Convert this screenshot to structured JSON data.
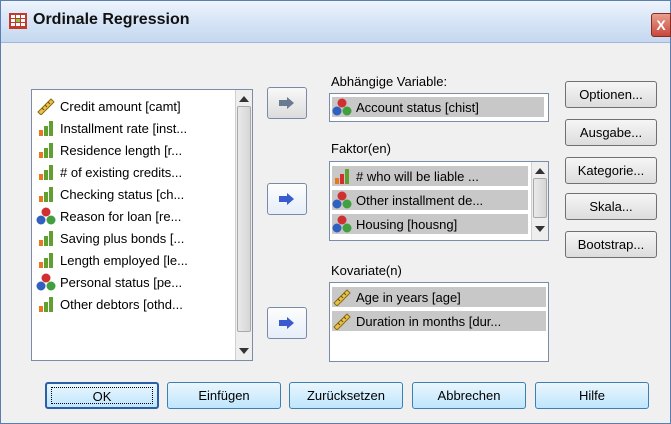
{
  "window": {
    "title": "Ordinale Regression",
    "close_glyph": "X"
  },
  "source_list": {
    "items": [
      {
        "label": "Credit amount [camt]",
        "icon": "scale-ruler-icon"
      },
      {
        "label": "Installment rate [inst...",
        "icon": "ordinal-bars-icon"
      },
      {
        "label": "Residence length [r...",
        "icon": "ordinal-bars-icon"
      },
      {
        "label": "# of existing credits...",
        "icon": "ordinal-bars-icon"
      },
      {
        "label": "Checking status [ch...",
        "icon": "ordinal-bars-icon"
      },
      {
        "label": "Reason for loan [re...",
        "icon": "nominal-balls-icon"
      },
      {
        "label": "Saving plus bonds [...",
        "icon": "ordinal-bars-icon"
      },
      {
        "label": "Length employed [le...",
        "icon": "ordinal-bars-icon"
      },
      {
        "label": "Personal status [pe...",
        "icon": "nominal-balls-icon"
      },
      {
        "label": "Other debtors [othd...",
        "icon": "ordinal-bars-icon"
      }
    ]
  },
  "dependent": {
    "label": "Abhängige Variable:",
    "value": "Account status [chist]",
    "icon": "nominal-balls-icon"
  },
  "factors": {
    "label": "Faktor(en)",
    "items": [
      {
        "label": "# who will be liable ...",
        "icon": "ordinal-bars-icon"
      },
      {
        "label": "Other installment de...",
        "icon": "nominal-balls-icon"
      },
      {
        "label": "Housing [housng]",
        "icon": "nominal-balls-icon"
      }
    ]
  },
  "covariates": {
    "label": "Kovariate(n)",
    "items": [
      {
        "label": "Age in years [age]",
        "icon": "scale-ruler-icon"
      },
      {
        "label": "Duration in months [dur...",
        "icon": "scale-ruler-icon"
      }
    ]
  },
  "side_buttons": {
    "optionen": "Optionen...",
    "ausgabe": "Ausgabe...",
    "kategorie": "Kategorie...",
    "skala": "Skala...",
    "bootstrap": "Bootstrap..."
  },
  "bottom_buttons": {
    "ok": "OK",
    "einfuegen": "Einfügen",
    "zuruecksetzen": "Zurücksetzen",
    "abbrechen": "Abbrechen",
    "hilfe": "Hilfe"
  }
}
